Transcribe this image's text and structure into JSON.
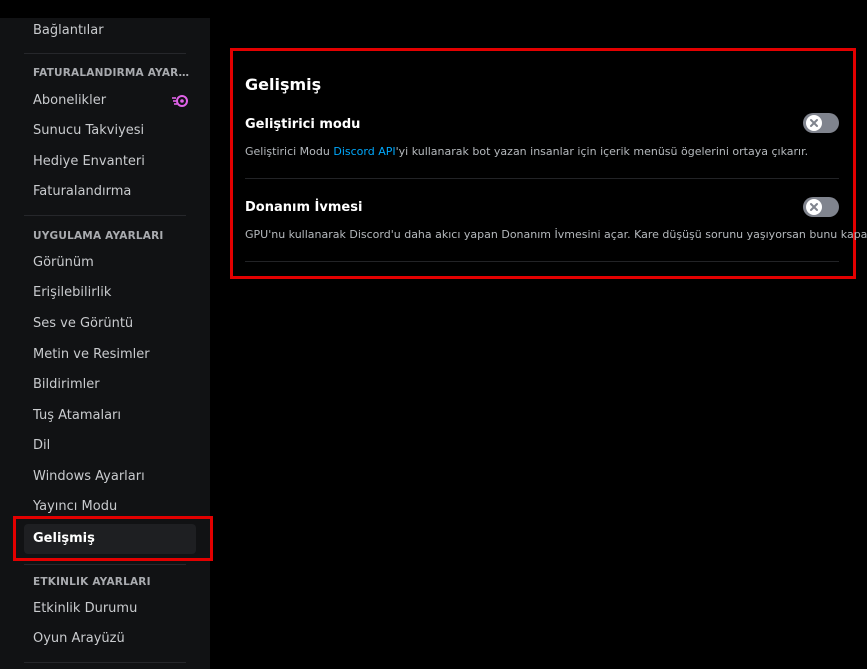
{
  "sidebar": {
    "items_top": [
      {
        "label": "Bağlantılar"
      }
    ],
    "billing": {
      "header": "FATURALANDIRMA AYARLARI",
      "items": [
        {
          "label": "Abonelikler",
          "icon": "nitro-icon"
        },
        {
          "label": "Sunucu Takviyesi"
        },
        {
          "label": "Hediye Envanteri"
        },
        {
          "label": "Faturalandırma"
        }
      ]
    },
    "app": {
      "header": "UYGULAMA AYARLARI",
      "items": [
        {
          "label": "Görünüm"
        },
        {
          "label": "Erişilebilirlik"
        },
        {
          "label": "Ses ve Görüntü"
        },
        {
          "label": "Metin ve Resimler"
        },
        {
          "label": "Bildirimler"
        },
        {
          "label": "Tuş Atamaları"
        },
        {
          "label": "Dil"
        },
        {
          "label": "Windows Ayarları"
        },
        {
          "label": "Yayıncı Modu"
        },
        {
          "label": "Gelişmiş",
          "active": true
        }
      ]
    },
    "activity": {
      "header": "ETKİNLİK AYARLARI",
      "items": [
        {
          "label": "Etkinlik Durumu"
        },
        {
          "label": "Oyun Arayüzü"
        }
      ]
    }
  },
  "main": {
    "title": "Gelişmiş",
    "options": [
      {
        "label": "Geliştirici modu",
        "desc_before": "Geliştirici Modu ",
        "desc_link": "Discord API",
        "desc_after": "'yi kullanarak bot yazan insanlar için içerik menüsü ögelerini ortaya çıkarır.",
        "enabled": false
      },
      {
        "label": "Donanım İvmesi",
        "desc": "GPU'nu kullanarak Discord'u daha akıcı yapan Donanım İvmesini açar. Kare düşüşü sorunu yaşıyorsan bunu kapat.",
        "enabled": false
      }
    ]
  },
  "colors": {
    "highlight": "#e30000",
    "link": "#00a8fc",
    "nitro": "#e062e8",
    "toggle_off": "#80848e"
  }
}
